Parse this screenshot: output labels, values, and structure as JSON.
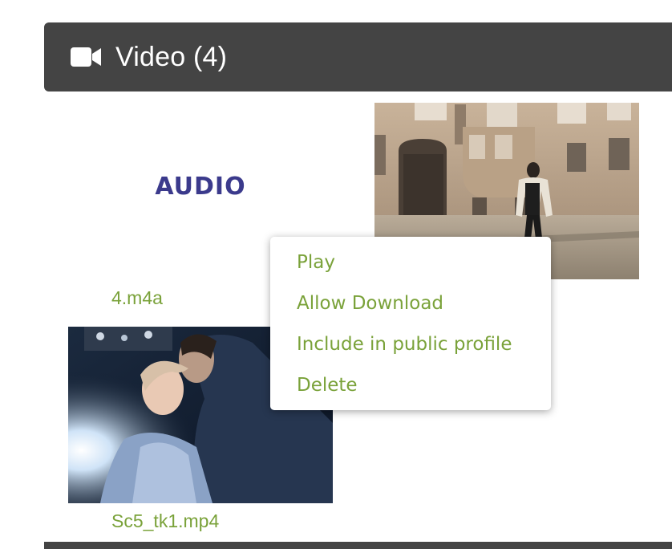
{
  "section": {
    "title": "Video (4)",
    "icon": "video-camera-icon"
  },
  "media": [
    {
      "thumb_text": "AUDIO",
      "filename": "4.m4a"
    },
    {
      "filename": ""
    },
    {
      "filename": "Sc5_tk1.mp4"
    }
  ],
  "context_menu": {
    "items": [
      {
        "label": "Play"
      },
      {
        "label": "Allow Download"
      },
      {
        "label": "Include in public profile"
      },
      {
        "label": "Delete"
      }
    ]
  },
  "colors": {
    "header_bg": "#444444",
    "link_green": "#7aa23a",
    "audio_label": "#3b3a8c"
  }
}
